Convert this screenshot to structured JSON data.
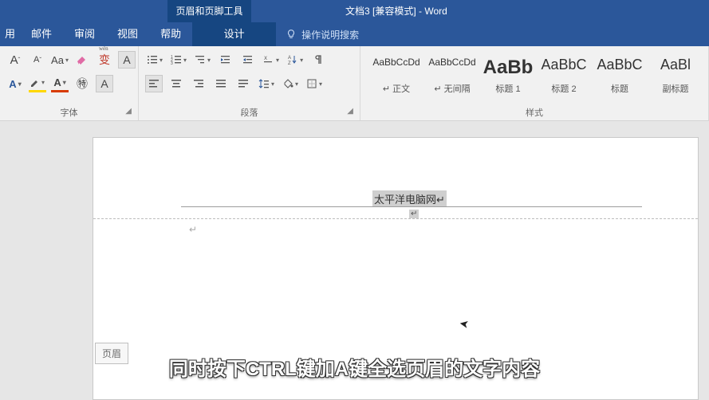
{
  "title": {
    "context_tool": "页眉和页脚工具",
    "document": "文档3 [兼容模式] - Word"
  },
  "tabs": {
    "use": "用",
    "mail": "邮件",
    "review": "审阅",
    "view": "视图",
    "help": "帮助",
    "design": "设计",
    "tell_me": "操作说明搜索"
  },
  "ribbon": {
    "font": {
      "grow": "A",
      "shrink": "A",
      "changecase": "Aa",
      "boxed": "A",
      "effect": "A",
      "highlight": "",
      "color": "A",
      "circled": "㊕",
      "border": "A",
      "label": "字体"
    },
    "para": {
      "label": "段落"
    },
    "styles": {
      "label": "样式",
      "items": [
        {
          "preview": "AaBbCcDd",
          "name": "↵ 正文",
          "sizeClass": "s1"
        },
        {
          "preview": "AaBbCcDd",
          "name": "↵ 无间隔",
          "sizeClass": "s1"
        },
        {
          "preview": "AaBb",
          "name": "标题 1",
          "sizeClass": "s3"
        },
        {
          "preview": "AaBbC",
          "name": "标题 2",
          "sizeClass": "s2"
        },
        {
          "preview": "AaBbC",
          "name": "标题",
          "sizeClass": "s2"
        },
        {
          "preview": "AaBl",
          "name": "副标题",
          "sizeClass": "s2"
        }
      ]
    }
  },
  "document": {
    "header_text": "太平洋电脑网↵",
    "header_flag": "页眉",
    "paragraph_mark": "↵",
    "header_handle": "↵"
  },
  "subtitle": "同时按下CTRL键加A键全选页眉的文字内容"
}
